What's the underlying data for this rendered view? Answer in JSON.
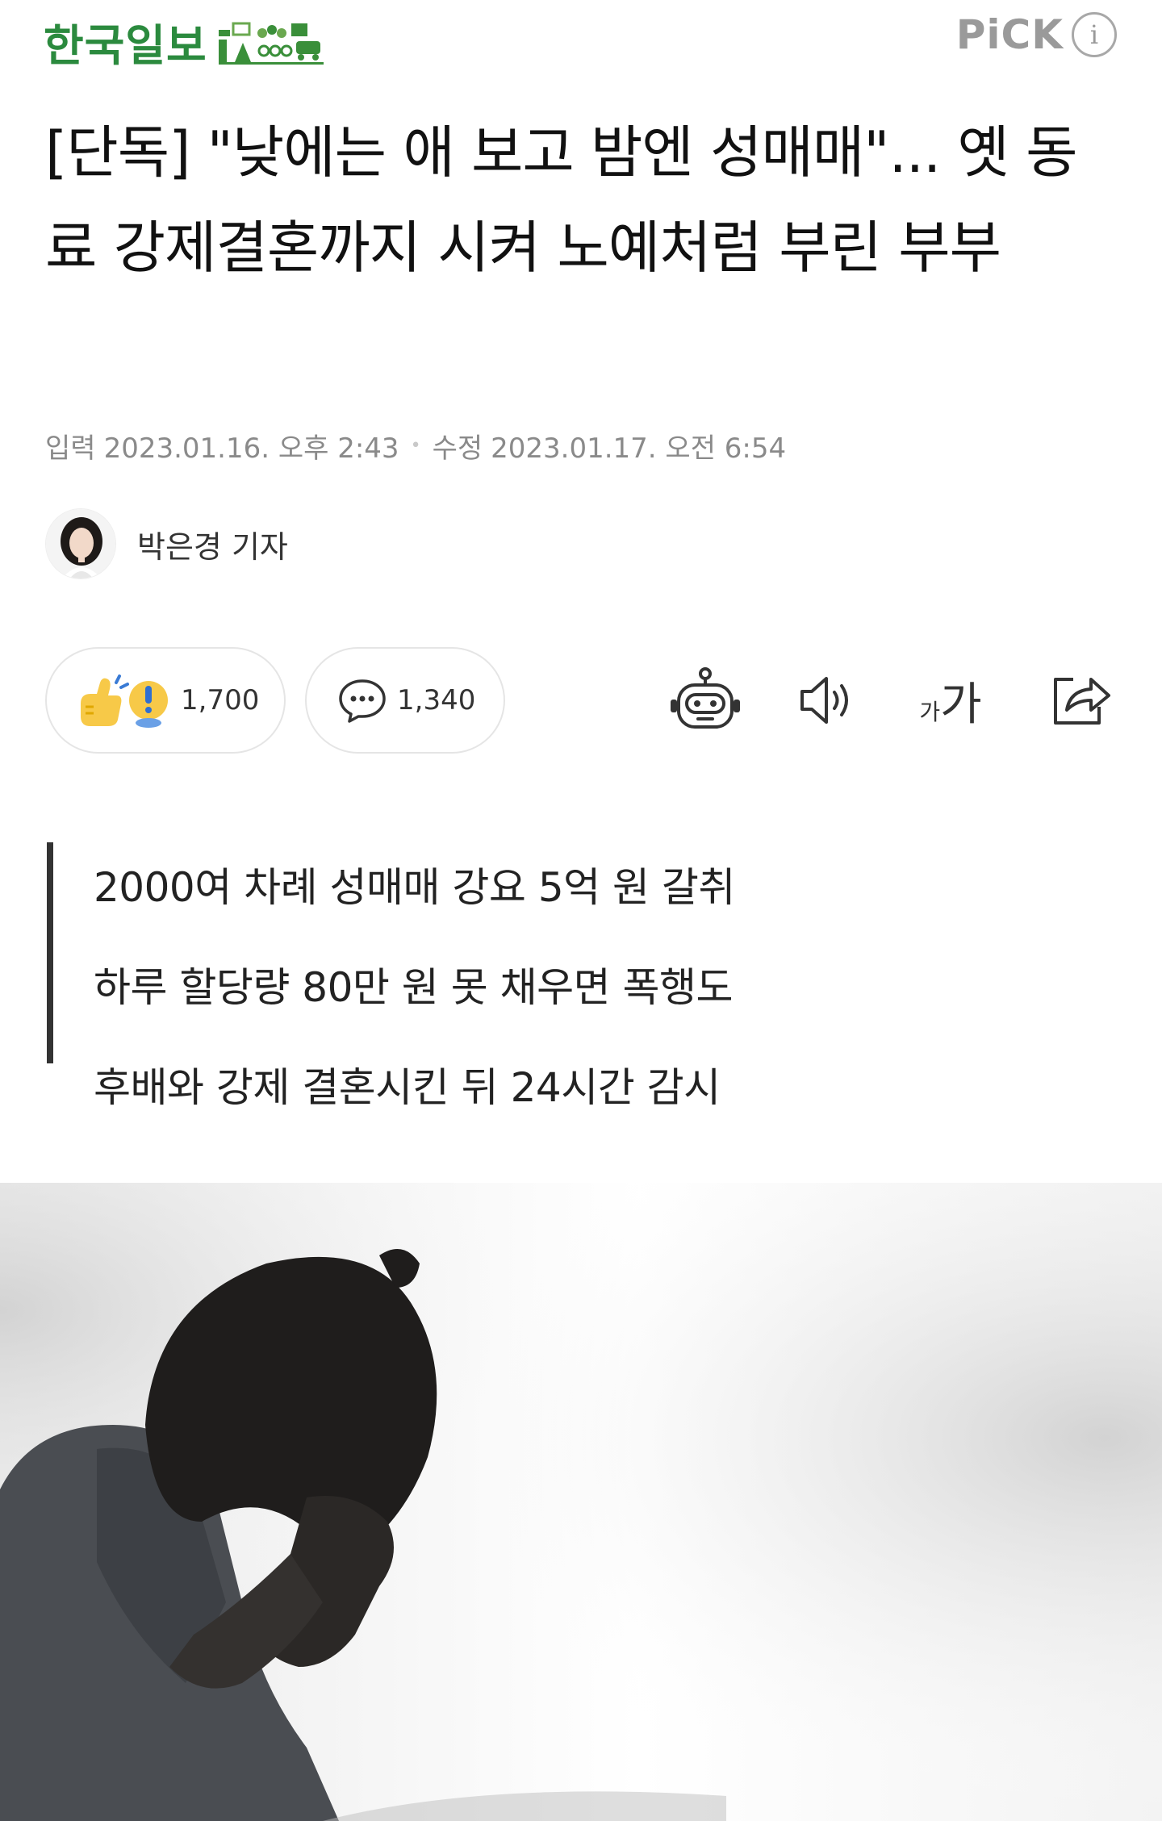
{
  "header": {
    "brand": "한국일보",
    "pick_label": "PiCK",
    "info_label": "i"
  },
  "article": {
    "headline": "[단독] \"낮에는 애 보고 밤엔 성매매\"... 옛 동료 강제결혼까지 시켜 노예처럼 부린 부부",
    "published_label": "입력",
    "published_at": "2023.01.16. 오후 2:43",
    "updated_label": "수정",
    "updated_at": "2023.01.17. 오전 6:54",
    "reporter": "박은경 기자",
    "summary": [
      "2000여 차례 성매매 강요 5억 원 갈취",
      "하루 할당량 80만 원 못 채우면 폭행도",
      "후배와 강제 결혼시킨 뒤 24시간 감시"
    ]
  },
  "actions": {
    "reaction_count": "1,700",
    "comment_count": "1,340",
    "font_small": "가",
    "font_big": "가"
  },
  "icons": [
    "reaction-emoji-icon",
    "comment-icon",
    "robot-summary-icon",
    "speaker-icon",
    "font-size-icon",
    "share-icon",
    "info-icon"
  ],
  "colors": {
    "brand_green": "#2b8a3e",
    "pick_gray": "#9a9a9a",
    "meta_gray": "#8a8a8a",
    "summary_bar": "#333333"
  }
}
